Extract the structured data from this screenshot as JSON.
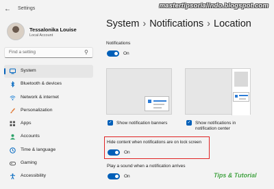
{
  "window": {
    "title": "Settings",
    "back_glyph": "←"
  },
  "watermark": {
    "top": "mastertipsorialindo.blogspot.com",
    "bottom": "Tips & Tutorial"
  },
  "user": {
    "name": "Tessalonika Louise",
    "account": "Local Account"
  },
  "search": {
    "placeholder": "Find a setting",
    "icon": "search-icon"
  },
  "sidebar": {
    "items": [
      {
        "label": "System",
        "icon": "system-icon",
        "color": "#0067c0",
        "active": true
      },
      {
        "label": "Bluetooth & devices",
        "icon": "bluetooth-icon",
        "color": "#0067c0"
      },
      {
        "label": "Network & internet",
        "icon": "network-icon",
        "color": "#2b88d8"
      },
      {
        "label": "Personalization",
        "icon": "brush-icon",
        "color": "#e07b39"
      },
      {
        "label": "Apps",
        "icon": "apps-icon",
        "color": "#555555"
      },
      {
        "label": "Accounts",
        "icon": "person-icon",
        "color": "#2ea36a"
      },
      {
        "label": "Time & language",
        "icon": "globe-clock-icon",
        "color": "#0067c0"
      },
      {
        "label": "Gaming",
        "icon": "gamepad-icon",
        "color": "#555555"
      },
      {
        "label": "Accessibility",
        "icon": "accessibility-icon",
        "color": "#0067c0"
      }
    ]
  },
  "breadcrumb": {
    "items": [
      "System",
      "Notifications",
      "Location"
    ],
    "separator": "›"
  },
  "content": {
    "notifications_label": "Notifications",
    "notifications_toggle": "On",
    "show_banners": "Show notification banners",
    "show_center": "Show notifications in notification center",
    "hide_content": "Hide content when notifications are on lock screen",
    "hide_toggle": "On",
    "play_sound": "Play a sound when a notification arrives",
    "sound_toggle": "On"
  },
  "colors": {
    "accent": "#005fb8",
    "highlight_border": "#e02020"
  }
}
